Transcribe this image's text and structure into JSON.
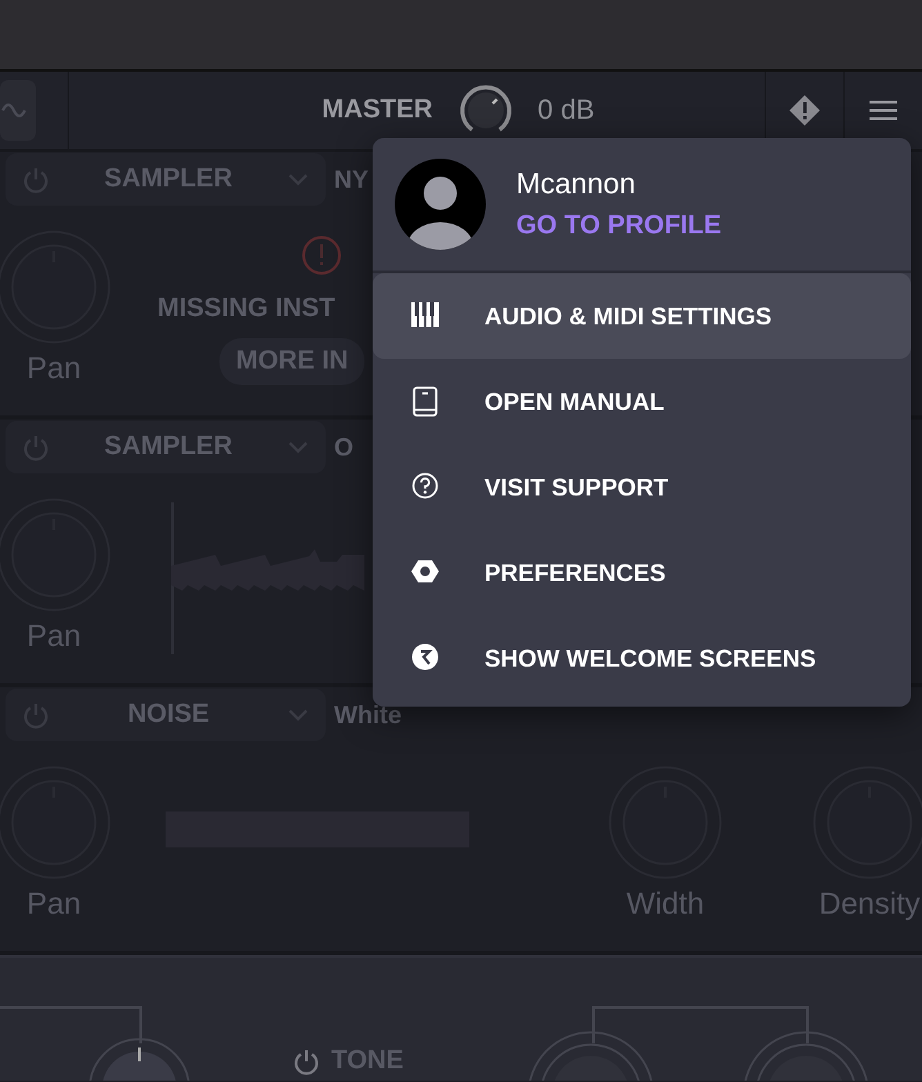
{
  "header": {
    "master_label": "MASTER",
    "master_value": "0 dB"
  },
  "layers": [
    {
      "engine": "SAMPLER",
      "name": "NY",
      "body": {
        "kind": "missing",
        "message": "MISSING INST",
        "button": "MORE IN"
      },
      "knobs": [
        "Pan"
      ]
    },
    {
      "engine": "SAMPLER",
      "name": "O",
      "body": {
        "kind": "waveform"
      },
      "knobs": [
        "Pan"
      ]
    },
    {
      "engine": "NOISE",
      "name": "White",
      "body": {
        "kind": "noise"
      },
      "knobs": [
        "Pan"
      ],
      "right_knobs": [
        "Width",
        "Density"
      ]
    }
  ],
  "bottom": {
    "tone_label": "TONE"
  },
  "menu": {
    "user": "Mcannon",
    "profile_link": "GO TO PROFILE",
    "items": [
      {
        "kind": "piano",
        "label": "AUDIO & MIDI SETTINGS",
        "selected": true
      },
      {
        "kind": "book",
        "label": "OPEN MANUAL",
        "selected": false
      },
      {
        "kind": "help",
        "label": "VISIT SUPPORT",
        "selected": false
      },
      {
        "kind": "hex",
        "label": "PREFERENCES",
        "selected": false
      },
      {
        "kind": "badge",
        "label": "SHOW WELCOME SCREENS",
        "selected": false
      }
    ]
  }
}
